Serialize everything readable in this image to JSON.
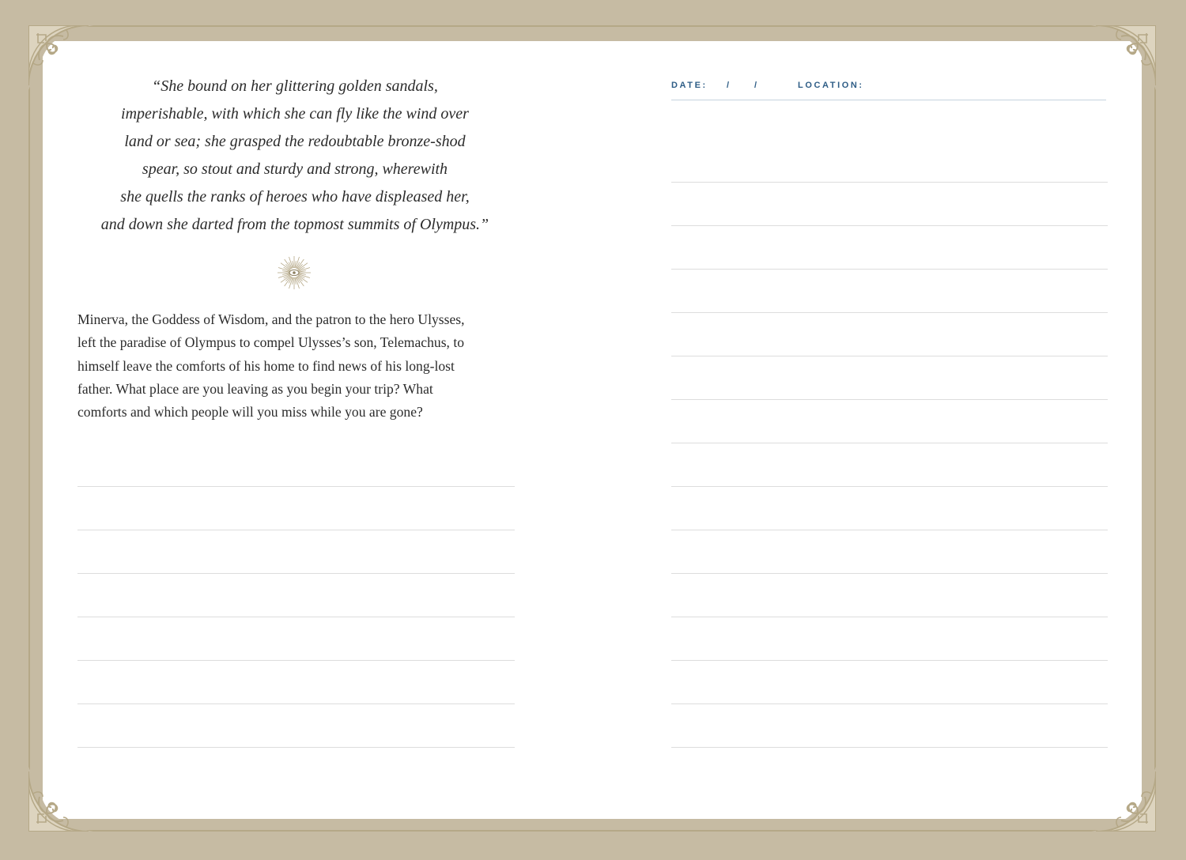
{
  "left_page": {
    "quote_lines": [
      "“She bound on her glittering golden sandals,",
      "imperishable, with which she can fly like the wind over",
      "land or sea; she grasped the redoubtable bronze-shod",
      "spear, so stout and sturdy and strong, wherewith",
      "she quells the ranks of heroes who have displeased her,",
      "and down she darted from the topmost summits of Olympus.”"
    ],
    "ornament_icon": "sunburst-icon",
    "prompt_lines": [
      "Minerva, the Goddess of Wisdom, and the patron to the hero Ulysses,",
      "left the paradise of Olympus to compel Ulysses’s son, Telemachus, to",
      "himself leave the comforts of his home to find news of his long-lost",
      "father. What place are you leaving as you begin your trip? What",
      "comforts and which people will you miss while you are gone?"
    ],
    "writing_line_count": 7
  },
  "right_page": {
    "date_label": "DATE:",
    "date_separators": [
      "/",
      "/"
    ],
    "location_label": "LOCATION:",
    "writing_line_count": 14
  },
  "colors": {
    "frame": "#c6bba3",
    "ornament": "#b5a887",
    "accent_blue": "#2e5d86",
    "rule_line": "#dddddd"
  }
}
